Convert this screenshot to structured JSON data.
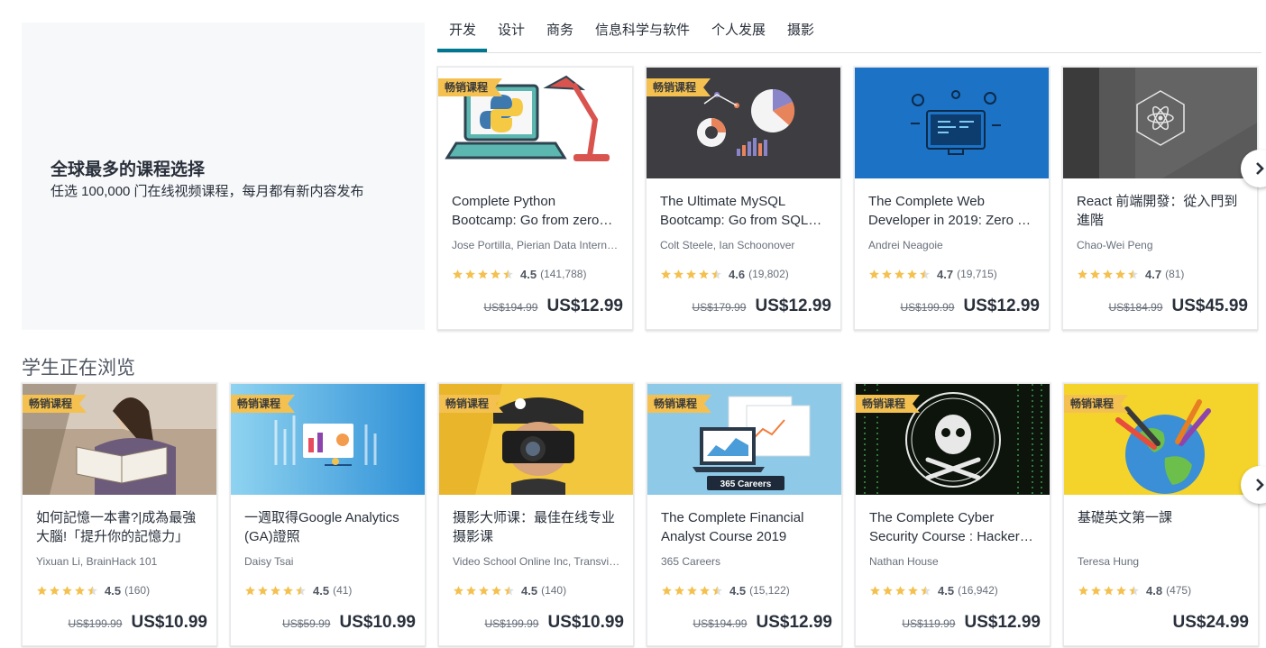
{
  "hero": {
    "title": "全球最多的课程选择",
    "subtitle": "任选 100,000 门在线视频课程，每月都有新内容发布"
  },
  "tabs": [
    "开发",
    "设计",
    "商务",
    "信息科学与软件",
    "个人发展",
    "摄影"
  ],
  "active_tab": "开发",
  "badge_label": "畅销课程",
  "section_title": "学生正在浏览",
  "top_courses": [
    {
      "title": "Complete Python Bootcamp: Go from zero…",
      "author": "Jose Portilla, Pierian Data Intern…",
      "rating": "4.5",
      "rating_value": 4.5,
      "reviews": "(141,788)",
      "old_price": "US$194.99",
      "price": "US$12.99",
      "badge": true,
      "thumb": "python"
    },
    {
      "title": "The Ultimate MySQL Bootcamp: Go from SQL…",
      "author": "Colt Steele, Ian Schoonover",
      "rating": "4.6",
      "rating_value": 4.6,
      "reviews": "(19,802)",
      "old_price": "US$179.99",
      "price": "US$12.99",
      "badge": true,
      "thumb": "mysql"
    },
    {
      "title": "The Complete Web Developer in 2019: Zero …",
      "author": "Andrei Neagoie",
      "rating": "4.7",
      "rating_value": 4.7,
      "reviews": "(19,715)",
      "old_price": "US$199.99",
      "price": "US$12.99",
      "badge": false,
      "thumb": "webdev"
    },
    {
      "title": "React 前端開發：從入門到進階",
      "author": "Chao-Wei Peng",
      "rating": "4.7",
      "rating_value": 4.7,
      "reviews": "(81)",
      "old_price": "US$184.99",
      "price": "US$45.99",
      "badge": false,
      "thumb": "react"
    }
  ],
  "browsing_courses": [
    {
      "title": "如何記憶一本書?|成為最強大腦!「提升你的記憶力」",
      "author": "Yixuan Li, BrainHack 101",
      "rating": "4.5",
      "rating_value": 4.5,
      "reviews": "(160)",
      "old_price": "US$199.99",
      "price": "US$10.99",
      "badge": true,
      "thumb": "reading"
    },
    {
      "title": "一週取得Google Analytics (GA)證照",
      "author": "Daisy Tsai",
      "rating": "4.5",
      "rating_value": 4.5,
      "reviews": "(41)",
      "old_price": "US$59.99",
      "price": "US$10.99",
      "badge": true,
      "thumb": "analytics"
    },
    {
      "title": "摄影大师课：最佳在线专业摄影课",
      "author": "Video School Online Inc, Transvi…",
      "rating": "4.5",
      "rating_value": 4.5,
      "reviews": "(140)",
      "old_price": "US$199.99",
      "price": "US$10.99",
      "badge": true,
      "thumb": "photo"
    },
    {
      "title": "The Complete Financial Analyst Course 2019",
      "author": "365 Careers",
      "rating": "4.5",
      "rating_value": 4.5,
      "reviews": "(15,122)",
      "old_price": "US$194.99",
      "price": "US$12.99",
      "badge": true,
      "thumb": "finance",
      "thumb_text": "365 Careers"
    },
    {
      "title": "The Complete Cyber Security Course : Hacker…",
      "author": "Nathan House",
      "rating": "4.5",
      "rating_value": 4.5,
      "reviews": "(16,942)",
      "old_price": "US$119.99",
      "price": "US$12.99",
      "badge": true,
      "thumb": "cyber"
    },
    {
      "title": "基礎英文第一課",
      "author": "Teresa Hung",
      "rating": "4.8",
      "rating_value": 4.8,
      "reviews": "(475)",
      "old_price": "",
      "price": "US$24.99",
      "badge": true,
      "thumb": "globe"
    }
  ],
  "icons": {
    "next_arrow": "chevron-right-icon",
    "star": "star-icon"
  },
  "colors": {
    "accent": "#007791",
    "badge": "#f4c150",
    "star": "#f4c150"
  }
}
